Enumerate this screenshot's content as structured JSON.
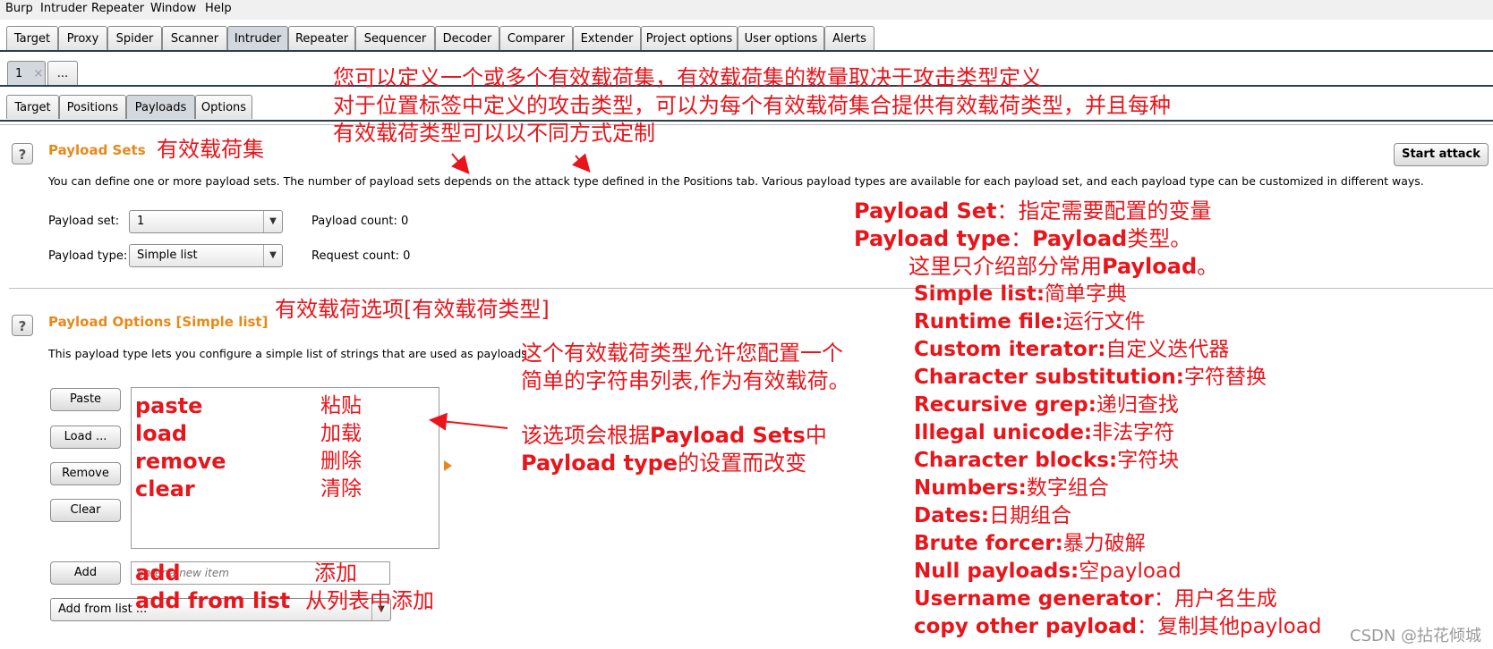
{
  "menubar": [
    "Burp",
    "Intruder",
    "Repeater",
    "Window",
    "Help"
  ],
  "main_tabs": [
    "Target",
    "Proxy",
    "Spider",
    "Scanner",
    "Intruder",
    "Repeater",
    "Sequencer",
    "Decoder",
    "Comparer",
    "Extender",
    "Project options",
    "User options",
    "Alerts"
  ],
  "active_main_tab": "Intruder",
  "attack_tabs": {
    "tab1": "1",
    "close": "×",
    "more": "..."
  },
  "sub_tabs": [
    "Target",
    "Positions",
    "Payloads",
    "Options"
  ],
  "active_sub_tab": "Payloads",
  "colors": {
    "accent_orange": "#e58a1a",
    "annotation_red": "#e8151b",
    "tab_line": "#2c3e50"
  },
  "payload_sets": {
    "title": "Payload Sets",
    "annotation": "有效载荷集",
    "description": "You can define one or more payload sets. The number of payload sets depends on the attack type defined in the Positions tab. Various payload types are available for each payload set, and each payload type can be customized in different ways.",
    "payload_set_label": "Payload set:",
    "payload_set_value": "1",
    "payload_type_label": "Payload type:",
    "payload_type_value": "Simple list",
    "payload_count": "Payload count:  0",
    "request_count": "Request count:  0",
    "start_attack": "Start attack"
  },
  "top_annotation": [
    "您可以定义一个或多个有效载荷集，有效载荷集的数量取决于攻击类型定义",
    "对于位置标签中定义的攻击类型，可以为每个有效载荷集合提供有效载荷类型，并且每种",
    "有效载荷类型可以以不同方式定制"
  ],
  "payload_options": {
    "title": "Payload Options [Simple list]",
    "annotation": "有效载荷选项[有效载荷类型]",
    "description": "This payload type lets you configure a simple list of strings that are used as payloads.",
    "desc_annotation": [
      "这个有效载荷类型允许您配置一个",
      "简单的字符串列表,作为有效载荷。"
    ],
    "buttons": [
      "Paste",
      "Load ...",
      "Remove",
      "Clear"
    ],
    "add_button": "Add",
    "add_placeholder": "Enter a new item",
    "add_from_list": "Add from list ...",
    "list_annotations": [
      {
        "en": "paste",
        "zh": "粘贴"
      },
      {
        "en": "load",
        "zh": "加载"
      },
      {
        "en": "remove",
        "zh": "删除"
      },
      {
        "en": "clear",
        "zh": "清除"
      }
    ],
    "add_annotation": {
      "en": "add",
      "zh": "添加"
    },
    "add_from_list_annotation": {
      "en": "add from list",
      "zh": "从列表中添加"
    },
    "change_note_1a": "该选项会根据",
    "change_note_1b": "Payload Sets",
    "change_note_1c": "中",
    "change_note_2a": "Payload type",
    "change_note_2b": "的设置而改变"
  },
  "right_notes": {
    "set_label": "Payload Set",
    "set_desc": "：指定需要配置的变量",
    "type_label": "Payload type",
    "type_desc_a": "：",
    "type_desc_b": "Payload",
    "type_desc_c": "类型。",
    "intro_a": "这里只介绍部分常用",
    "intro_b": "Payload",
    "intro_c": "。",
    "types": [
      {
        "en": "Simple list:",
        "zh": "简单字典"
      },
      {
        "en": "Runtime file:",
        "zh": "运行文件"
      },
      {
        "en": "Custom iterator:",
        "zh": "自定义迭代器"
      },
      {
        "en": "Character substitution:",
        "zh": "字符替换"
      },
      {
        "en": "Recursive grep:",
        "zh": "递归查找"
      },
      {
        "en": "Illegal unicode:",
        "zh": "非法字符"
      },
      {
        "en": "Character blocks:",
        "zh": "字符块"
      },
      {
        "en": "Numbers:",
        "zh": "数字组合"
      },
      {
        "en": "Dates:",
        "zh": "日期组合"
      },
      {
        "en": "Brute forcer:",
        "zh": "暴力破解"
      },
      {
        "en": "Null payloads:",
        "zh": "空payload"
      },
      {
        "en": "Username generator",
        "zh": "：用户名生成"
      },
      {
        "en": "copy other payload",
        "zh": "：复制其他payload"
      }
    ]
  },
  "watermark": "CSDN @拈花倾城"
}
